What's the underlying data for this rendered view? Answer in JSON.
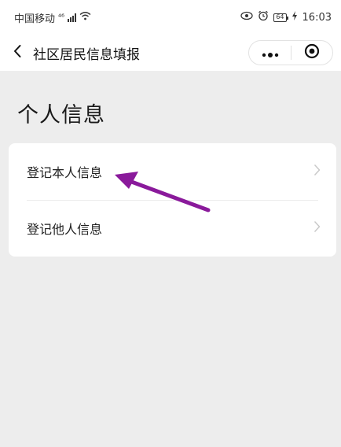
{
  "status_bar": {
    "carrier": "中国移动",
    "network": "⁴⁶",
    "battery_level": "64",
    "time": "16:03"
  },
  "nav": {
    "title": "社区居民信息填报"
  },
  "main": {
    "section_title": "个人信息",
    "items": [
      {
        "label": "登记本人信息"
      },
      {
        "label": "登记他人信息"
      }
    ]
  },
  "colors": {
    "page_background": "#ededed",
    "card_background": "#ffffff",
    "annotation_arrow": "#8a1a9b"
  },
  "icons": {
    "back": "chevron-left-icon",
    "more": "more-dots-icon",
    "close": "target-circle-icon",
    "row_chevron": "chevron-right-icon"
  }
}
